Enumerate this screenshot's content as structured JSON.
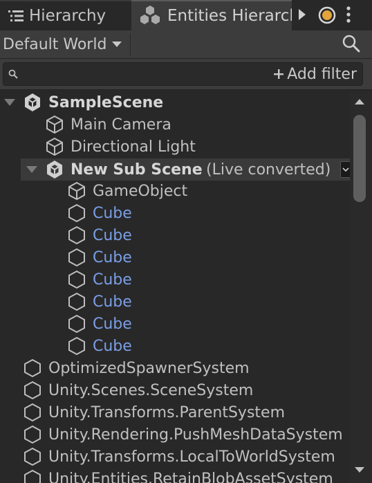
{
  "tabs": {
    "hierarchy_label": "Hierarchy",
    "entities_label": "Entities Hierarch"
  },
  "toolbar": {
    "world_label": "Default World"
  },
  "search": {
    "value": "",
    "add_filter_label": "Add filter"
  },
  "tree": {
    "scene": "SampleScene",
    "main_camera": "Main Camera",
    "directional_light": "Directional Light",
    "subscene_name": "New Sub Scene",
    "subscene_status": "(Live converted)",
    "game_object": "GameObject",
    "cubes": [
      "Cube",
      "Cube",
      "Cube",
      "Cube",
      "Cube",
      "Cube",
      "Cube"
    ],
    "systems": [
      "OptimizedSpawnerSystem",
      "Unity.Scenes.SceneSystem",
      "Unity.Transforms.ParentSystem",
      "Unity.Rendering.PushMeshDataSystem",
      "Unity.Transforms.LocalToWorldSystem",
      "Unity.Entities.RetainBlobAssetSystem"
    ]
  },
  "colors": {
    "entity_blue": "#7a9ee6",
    "accent_orange": "#e2a43c"
  },
  "icons": [
    "list-icon",
    "entities-icon",
    "play-icon",
    "record-icon",
    "kebab-menu-icon",
    "search-icon",
    "triangle-down-icon",
    "unity-scene-icon",
    "cube-icon",
    "hexagon-icon",
    "scroll-up-icon",
    "scroll-down-icon"
  ]
}
